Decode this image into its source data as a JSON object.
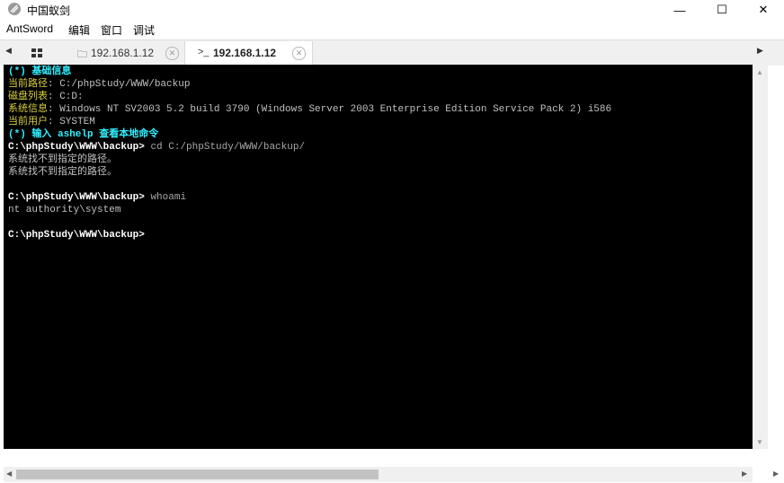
{
  "window": {
    "title": "中国蚁剑",
    "minimize": "—",
    "maximize": "☐",
    "close": "✕"
  },
  "menu": [
    "AntSword",
    "编辑",
    "窗口",
    "调试"
  ],
  "tabs": [
    {
      "label": "192.168.1.12",
      "icon": "folder-icon",
      "active": false
    },
    {
      "label": "192.168.1.12",
      "icon": "terminal-icon",
      "active": true
    }
  ],
  "tab_icons": {
    "folder": "🗀",
    "terminal": ">_"
  },
  "terminal_lines": [
    [
      {
        "t": "(*) 基础信息",
        "c": "c-cyan"
      }
    ],
    [
      {
        "t": "当前路径",
        "c": "c-yellow"
      },
      {
        "t": ": C:/phpStudy/WWW/backup",
        "c": "c-gray"
      }
    ],
    [
      {
        "t": "磁盘列表",
        "c": "c-yellow"
      },
      {
        "t": ": C:D:",
        "c": "c-gray"
      }
    ],
    [
      {
        "t": "系统信息",
        "c": "c-yellow"
      },
      {
        "t": ": Windows NT SV2003 5.2 build 3790 (Windows Server 2003 Enterprise Edition Service Pack 2) i586",
        "c": "c-gray"
      }
    ],
    [
      {
        "t": "当前用户",
        "c": "c-yellow"
      },
      {
        "t": ": SYSTEM",
        "c": "c-gray"
      }
    ],
    [
      {
        "t": "(*) 输入 ashelp 查看本地命令",
        "c": "c-cyan"
      }
    ],
    [
      {
        "t": "C:\\phpStudy\\WWW\\backup> ",
        "c": "c-white"
      },
      {
        "t": "cd C:/phpStudy/WWW/backup/",
        "c": "c-cmd"
      }
    ],
    [
      {
        "t": "系统找不到指定的路径。",
        "c": "c-gray"
      }
    ],
    [
      {
        "t": "系统找不到指定的路径。",
        "c": "c-gray"
      }
    ],
    [],
    [
      {
        "t": "C:\\phpStudy\\WWW\\backup> ",
        "c": "c-white"
      },
      {
        "t": "whoami",
        "c": "c-cmd"
      }
    ],
    [
      {
        "t": "nt authority\\system",
        "c": "c-gray"
      }
    ],
    [],
    [
      {
        "t": "C:\\phpStudy\\WWW\\backup>",
        "c": "c-white"
      }
    ]
  ],
  "colors": {
    "terminal_bg": "#000000",
    "cyan": "#2ff0ff",
    "yellow": "#d9cf3d"
  }
}
